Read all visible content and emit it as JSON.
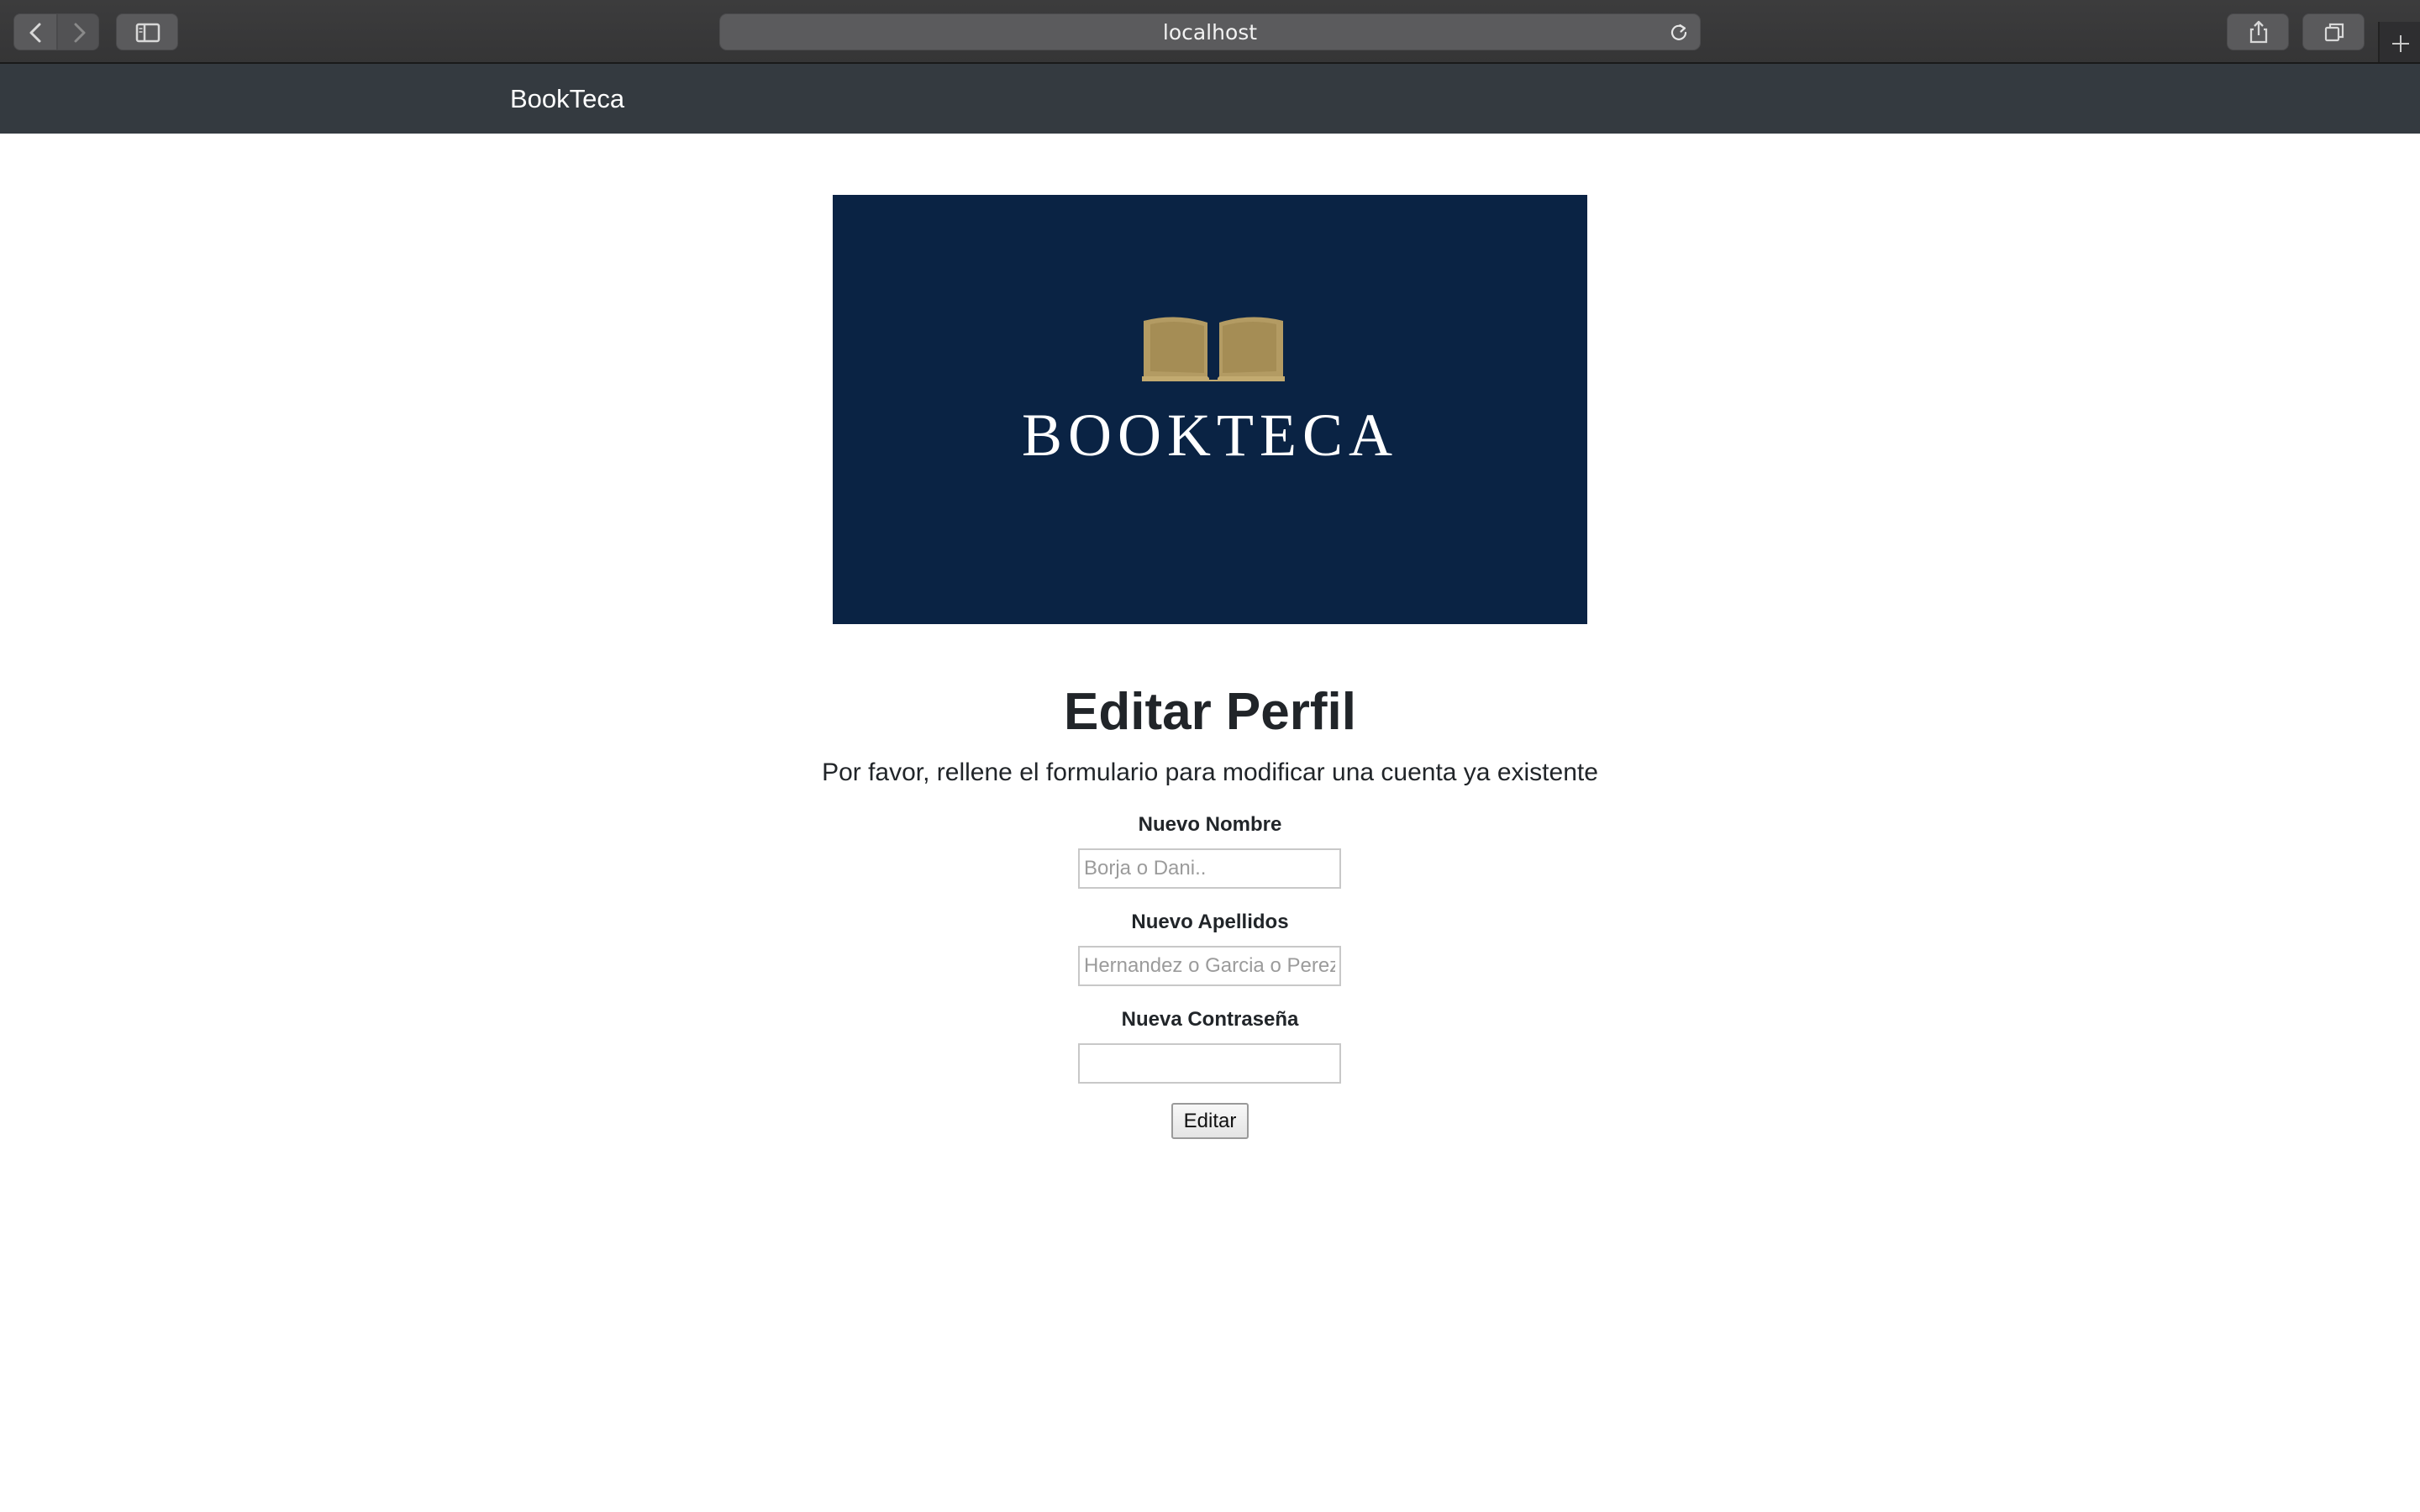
{
  "browser": {
    "url": "localhost",
    "icons": {
      "back": "chevron-left-icon",
      "forward": "chevron-right-icon",
      "sidebar": "sidebar-icon",
      "reload": "reload-icon",
      "share": "share-icon",
      "tabs": "tabs-overview-icon",
      "new_tab": "plus-icon"
    }
  },
  "navbar": {
    "brand": "BookTeca"
  },
  "logo": {
    "text": "BOOKTECA",
    "colors": {
      "background": "#0a2344",
      "book": "#b39b63",
      "text": "#ffffff"
    }
  },
  "form": {
    "title": "Editar Perfil",
    "intro": "Por favor, rellene el formulario para modificar una cuenta ya existente",
    "fields": [
      {
        "label": "Nuevo Nombre",
        "placeholder": "Borja o Dani..",
        "value": ""
      },
      {
        "label": "Nuevo Apellidos",
        "placeholder": "Hernandez o Garcia o Perez..",
        "value": ""
      },
      {
        "label": "Nueva Contraseña",
        "placeholder": "",
        "value": ""
      }
    ],
    "submit_label": "Editar"
  },
  "colors": {
    "navbar_bg": "#343a40",
    "navbar_text": "#ffffff",
    "chrome_bg": "#3c3c3d"
  }
}
